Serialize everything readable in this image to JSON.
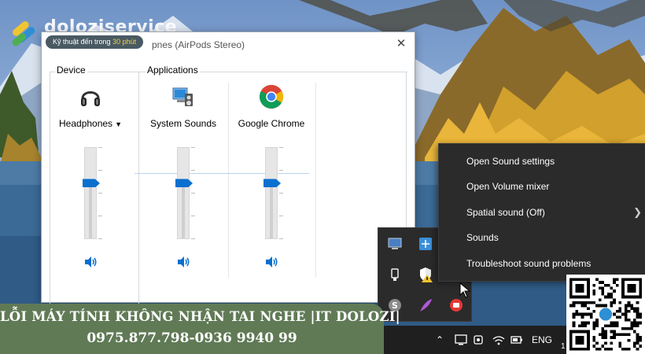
{
  "brand": {
    "name": "doloziservice",
    "tagline_prefix": "Kỹ thuật đến trong",
    "tagline_highlight": "30 phút"
  },
  "mixer": {
    "title": "pnes (AirPods Stereo)",
    "close_icon": "close-icon",
    "device_group_label": "Device",
    "applications_group_label": "Applications",
    "channels": [
      {
        "label": "Headphones",
        "icon": "headphones-icon",
        "has_dropdown": true,
        "level": 0.62
      },
      {
        "label": "System Sounds",
        "icon": "system-sounds-icon",
        "has_dropdown": false,
        "level": 0.62
      },
      {
        "label": "Google Chrome",
        "icon": "chrome-icon",
        "has_dropdown": false,
        "level": 0.62
      }
    ]
  },
  "context_menu": {
    "items": [
      {
        "label": "Open Sound settings",
        "has_submenu": false
      },
      {
        "label": "Open Volume mixer",
        "has_submenu": false
      },
      {
        "label": "Spatial sound (Off)",
        "has_submenu": true
      },
      {
        "label": "Sounds",
        "has_submenu": false
      },
      {
        "label": "Troubleshoot sound problems",
        "has_submenu": false
      }
    ]
  },
  "taskbar": {
    "language": "ENG",
    "clock_partial": "1"
  },
  "promo": {
    "title": "LỖI MÁY TÍNH KHÔNG NHẬN TAI NGHE |IT DOLOZI|",
    "phones": "0975.877.798-0936 9940 99"
  },
  "colors": {
    "accent_blue": "#0a6fcf",
    "menu_bg": "#2b2b2b",
    "banner_green": "#607a56",
    "tag_highlight": "#f3d046"
  }
}
